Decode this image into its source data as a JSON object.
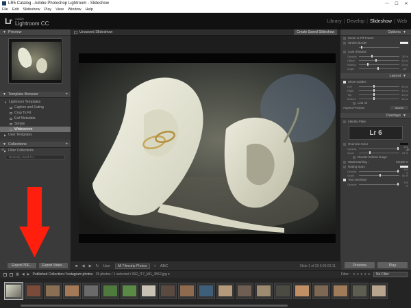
{
  "window": {
    "title": "LR5 Catalog - Adobe Photoshop Lightroom - Slideshow",
    "controls": [
      "—",
      "☐",
      "✕"
    ]
  },
  "menu": [
    "File",
    "Edit",
    "Slideshow",
    "Play",
    "View",
    "Window",
    "Help"
  ],
  "identity": {
    "logo": "Lr",
    "adobe": "Adobe",
    "product": "Lightroom CC",
    "modules": [
      "Library",
      "Develop",
      "Slideshow",
      "Web"
    ],
    "active_module": "Slideshow"
  },
  "left_panel": {
    "preview_label": "Preview",
    "template_browser_label": "Template Browser",
    "templates": [
      {
        "label": "Lightroom Templates",
        "type": "folder"
      },
      {
        "label": "Caption and Rating",
        "type": "item"
      },
      {
        "label": "Crop To Fit",
        "type": "item"
      },
      {
        "label": "Exif Metadata",
        "type": "item"
      },
      {
        "label": "Simple",
        "type": "item"
      },
      {
        "label": "Widescreen",
        "type": "item",
        "selected": true
      },
      {
        "label": "User Templates",
        "type": "folder"
      }
    ],
    "collections_label": "Collections",
    "collections": [
      {
        "label": "Filter Collections"
      }
    ],
    "collections_search": "Recently Used Fo...",
    "export_pdf": "Export PDF...",
    "export_video": "Export Video..."
  },
  "center": {
    "title": "Unsaved Slideshow",
    "save_button": "Create Saved Slideshow",
    "toolbar": {
      "use_label": "Use:",
      "use_value": "All Filmstrip Photos",
      "abc": "ABC",
      "slide_count": "Slide 1 of 29  0:00:00:11"
    }
  },
  "right_panel": {
    "options_label": "Options",
    "options": [
      {
        "label": "Zoom to Fill Frame",
        "checked": false
      },
      {
        "label": "Stroke Border",
        "checked": false
      },
      {
        "label": "Cast Shadow",
        "checked": false
      }
    ],
    "shadow_sliders": [
      {
        "label": "Opacity",
        "value": "30 %",
        "level": 0.3
      },
      {
        "label": "Offset",
        "value": "40 px",
        "level": 0.4
      },
      {
        "label": "Radius",
        "value": "20 px",
        "level": 0.2
      },
      {
        "label": "Angle",
        "value": "-35 °",
        "level": 0.45
      }
    ],
    "layout_label": "Layout",
    "show_guides": "Show Guides",
    "layout_sliders": [
      {
        "label": "Left",
        "value": "43 px",
        "level": 0.35
      },
      {
        "label": "Right",
        "value": "43 px",
        "level": 0.35
      },
      {
        "label": "Top",
        "value": "43 px",
        "level": 0.35
      },
      {
        "label": "Bottom",
        "value": "43 px",
        "level": 0.35
      }
    ],
    "link_all": "Link All",
    "aspect_label": "Aspect Preview",
    "aspect_value": "Screen",
    "overlays_label": "Overlays",
    "identity_plate_label": "Identity Plate",
    "identity_plate_text": "Lr 6",
    "override_color": "Override Color",
    "overlay_sliders": [
      {
        "label": "Opacity",
        "value": "100 %",
        "level": 1.0
      },
      {
        "label": "Scale",
        "value": "25 %",
        "level": 0.25
      }
    ],
    "render_behind": "Render behind image",
    "watermarking_label": "Watermarking :",
    "watermark_value": "Simple C",
    "rating_stars": "Rating Stars",
    "rating_sliders": [
      {
        "label": "Opacity",
        "value": "100 %",
        "level": 1.0
      },
      {
        "label": "Scale",
        "value": "50 %",
        "level": 0.5
      }
    ],
    "text_overlays": "Text Overlays",
    "text_sliders": [
      {
        "label": "Opacity",
        "value": "100 %",
        "level": 1.0
      }
    ],
    "preview_button": "Preview",
    "play_button": "Play"
  },
  "filmstrip": {
    "nav": [
      "1",
      "2"
    ],
    "path": "Published Collection / Instagram photos",
    "count": "29 photos / 1 selected / 092_IT7_MG_3552.jpg ▾",
    "filter_label": "Filter :",
    "filter_value": "No Filter",
    "stars": "★★★★★"
  },
  "colors": {
    "accent_arrow": "#ff1f0c",
    "panel": "#3a3a3a",
    "stage": "#1d1d1d"
  }
}
